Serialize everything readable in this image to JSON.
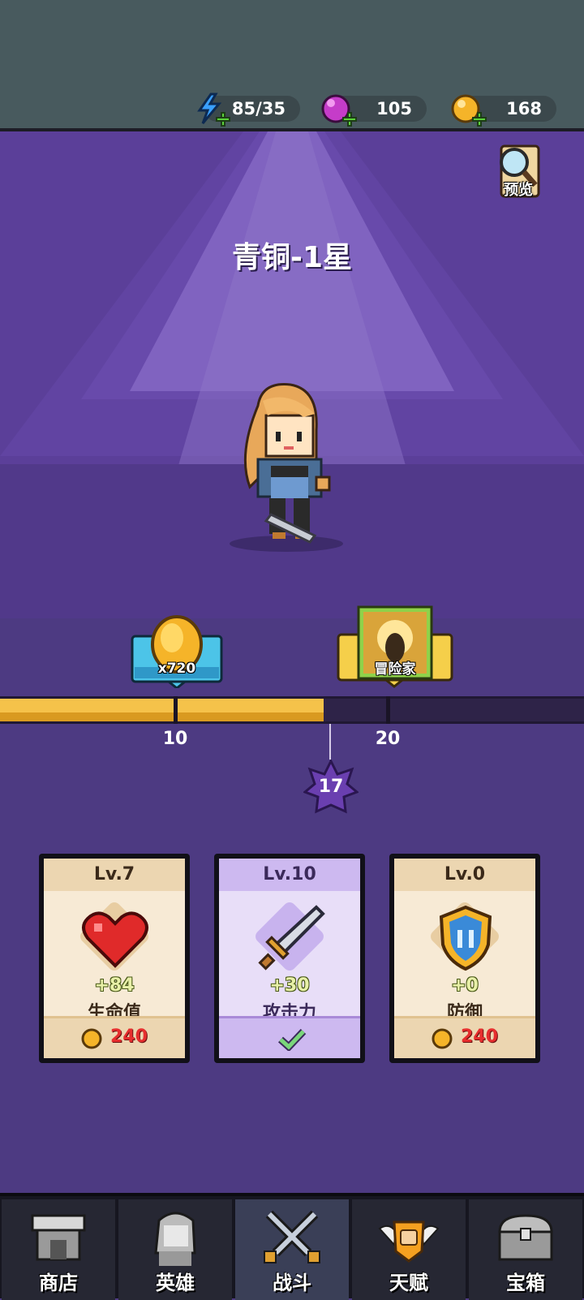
{
  "resources": {
    "energy": {
      "value": "85/35",
      "icon": "lightning-icon",
      "color": "#3aa0ff"
    },
    "gems": {
      "value": "105",
      "icon": "gem-icon",
      "color": "#c53cc9"
    },
    "coins": {
      "value": "168",
      "icon": "coin-icon",
      "color": "#f5b429"
    }
  },
  "preview_label": "预览",
  "rank_title": "青铜-1星",
  "progress": {
    "current_level": "17",
    "min_level": 0,
    "max_level": 27,
    "milestones": [
      {
        "level": "10",
        "reward_icon": "coin-icon",
        "reward_label": "x720"
      },
      {
        "level": "20",
        "reward_icon": "adventurer-card-icon",
        "reward_label": "冒险家"
      }
    ]
  },
  "cards": [
    {
      "level": "Lv.7",
      "icon": "heart-icon",
      "bonus": "+84",
      "name": "生命值",
      "cost": "240",
      "selected": false
    },
    {
      "level": "Lv.10",
      "icon": "sword-icon",
      "bonus": "+30",
      "name": "攻击力",
      "cost": "",
      "selected": true
    },
    {
      "level": "Lv.0",
      "icon": "shield-icon",
      "bonus": "+0",
      "name": "防御",
      "cost": "240",
      "selected": false
    }
  ],
  "nav": [
    {
      "label": "商店",
      "icon": "shop-icon"
    },
    {
      "label": "英雄",
      "icon": "hero-icon"
    },
    {
      "label": "战斗",
      "icon": "crossed-swords-icon",
      "active": true
    },
    {
      "label": "天赋",
      "icon": "fist-wings-icon"
    },
    {
      "label": "宝箱",
      "icon": "chest-icon"
    }
  ]
}
